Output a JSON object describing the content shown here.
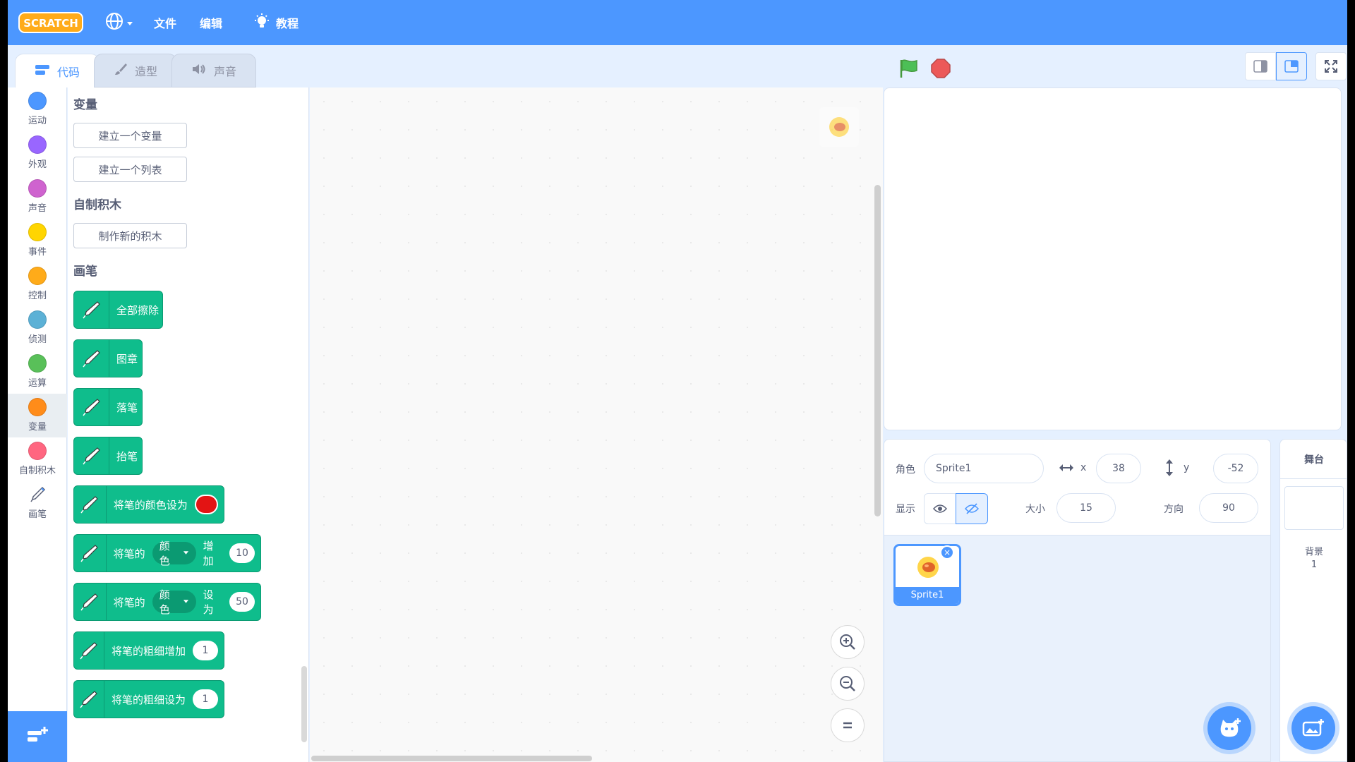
{
  "menubar": {
    "logo_text": "SCRATCH",
    "file_label": "文件",
    "edit_label": "编辑",
    "tutorials_label": "教程",
    "language_icon": "globe-icon"
  },
  "tabs": [
    {
      "label": "代码",
      "icon": "code-icon",
      "active": true
    },
    {
      "label": "造型",
      "icon": "brush-icon",
      "active": false
    },
    {
      "label": "声音",
      "icon": "speaker-icon",
      "active": false
    }
  ],
  "categories": [
    {
      "label": "运动",
      "color": "#4c97ff"
    },
    {
      "label": "外观",
      "color": "#9966ff"
    },
    {
      "label": "声音",
      "color": "#cf63cf"
    },
    {
      "label": "事件",
      "color": "#ffd500"
    },
    {
      "label": "控制",
      "color": "#ffab19"
    },
    {
      "label": "侦测",
      "color": "#5cb1d6"
    },
    {
      "label": "运算",
      "color": "#59c059"
    },
    {
      "label": "变量",
      "color": "#ff8c1a"
    },
    {
      "label": "自制积木",
      "color": "#ff6680"
    },
    {
      "label": "画笔",
      "color": "#0fbd8c"
    }
  ],
  "palette": {
    "variables_title": "变量",
    "make_variable": "建立一个变量",
    "make_list": "建立一个列表",
    "my_blocks_title": "自制积木",
    "make_block": "制作新的积木",
    "pen_title": "画笔",
    "blocks": {
      "erase_all": "全部擦除",
      "stamp": "图章",
      "pen_down": "落笔",
      "pen_up": "抬笔",
      "set_color_to": "将笔的颜色设为",
      "change_prefix": "将笔的",
      "change_dropdown": "颜色",
      "change_suffix": "增加",
      "change_value": "10",
      "set_prefix": "将笔的",
      "set_dropdown": "颜色",
      "set_suffix": "设为",
      "set_value": "50",
      "change_size": "将笔的粗细增加",
      "change_size_value": "1",
      "set_size": "将笔的粗细设为",
      "set_size_value": "1"
    }
  },
  "sprite_info": {
    "sprite_label": "角色",
    "sprite_name": "Sprite1",
    "x_label": "x",
    "x_value": "38",
    "y_label": "y",
    "y_value": "-52",
    "show_label": "显示",
    "size_label": "大小",
    "size_value": "15",
    "direction_label": "方向",
    "direction_value": "90"
  },
  "sprites": [
    {
      "name": "Sprite1",
      "visible_name": "Sprite1",
      "selected": true
    }
  ],
  "stage_pane": {
    "title": "舞台",
    "backdrops_label": "背景",
    "backdrops_count": "1"
  },
  "colors": {
    "menubar": "#4c97ff",
    "pen_block": "#0fbd8c",
    "pen_color_swatch": "#e31414",
    "stop": "#ec5959",
    "flag": "#4cbf56"
  }
}
